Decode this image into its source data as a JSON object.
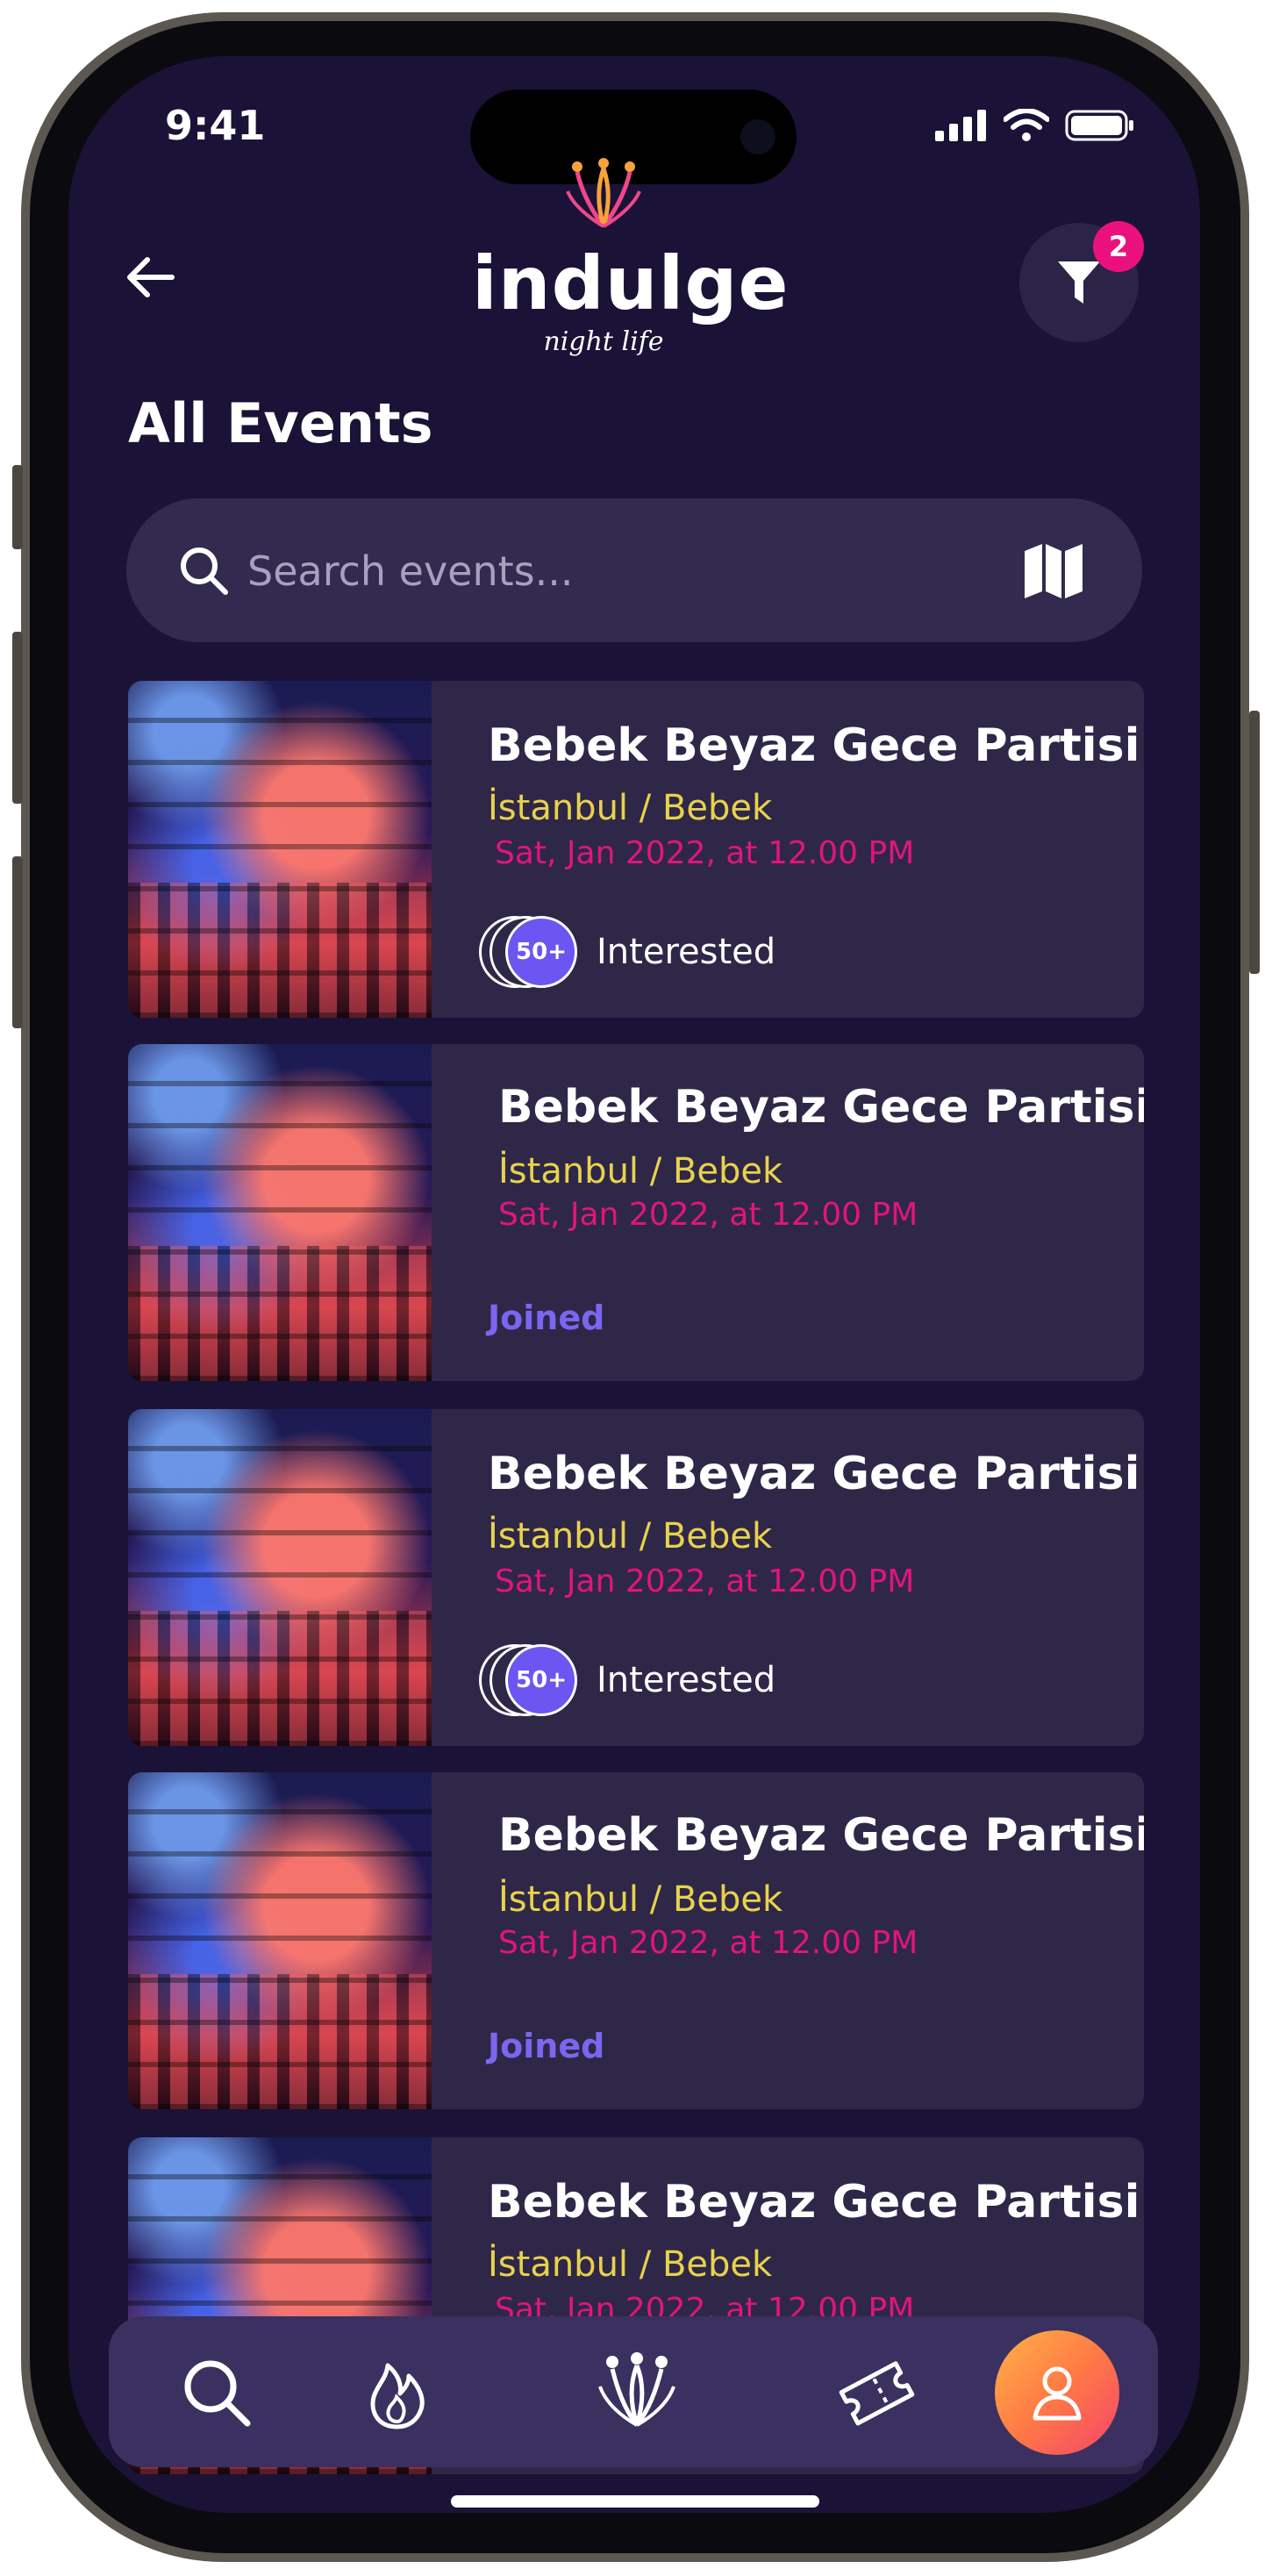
{
  "status_bar": {
    "time": "9:41"
  },
  "header": {
    "logo_word": "indulge",
    "logo_tagline": "night life",
    "filter_badge": "2"
  },
  "page": {
    "title": "All Events"
  },
  "search": {
    "placeholder": "Search events..."
  },
  "events": [
    {
      "title": "Bebek Beyaz Gece Partisi",
      "location": "İstanbul / Bebek",
      "date": "Sat, Jan 2022, at 12.00 PM",
      "status": "interested",
      "count": "50+",
      "status_label": "Interested"
    },
    {
      "title": "Bebek Beyaz Gece Partisi",
      "location": "İstanbul / Bebek",
      "date": "Sat, Jan 2022, at 12.00 PM",
      "status": "joined",
      "status_label": "Joined"
    },
    {
      "title": "Bebek Beyaz Gece Partisi",
      "location": "İstanbul / Bebek",
      "date": "Sat, Jan 2022, at 12.00 PM",
      "status": "interested",
      "count": "50+",
      "status_label": "Interested"
    },
    {
      "title": "Bebek Beyaz Gece Partisi",
      "location": "İstanbul / Bebek",
      "date": "Sat, Jan 2022, at 12.00 PM",
      "status": "joined",
      "status_label": "Joined"
    },
    {
      "title": "Bebek Beyaz Gece Partisi",
      "location": "İstanbul / Bebek",
      "date": "Sat, Jan 2022, at 12.00 PM",
      "status": "none"
    }
  ],
  "nav": {
    "items": [
      {
        "icon": "search-icon"
      },
      {
        "icon": "fire-icon"
      },
      {
        "icon": "indulge-logo-icon"
      },
      {
        "icon": "ticket-icon"
      },
      {
        "icon": "profile-icon",
        "active": true
      }
    ]
  },
  "colors": {
    "background": "#1b1237",
    "card": "#2f2748",
    "location": "#e8d24c",
    "date": "#e0157d",
    "joined": "#7c66f0",
    "badge": "#ea117f",
    "avatar_count": "#6b56f2"
  }
}
